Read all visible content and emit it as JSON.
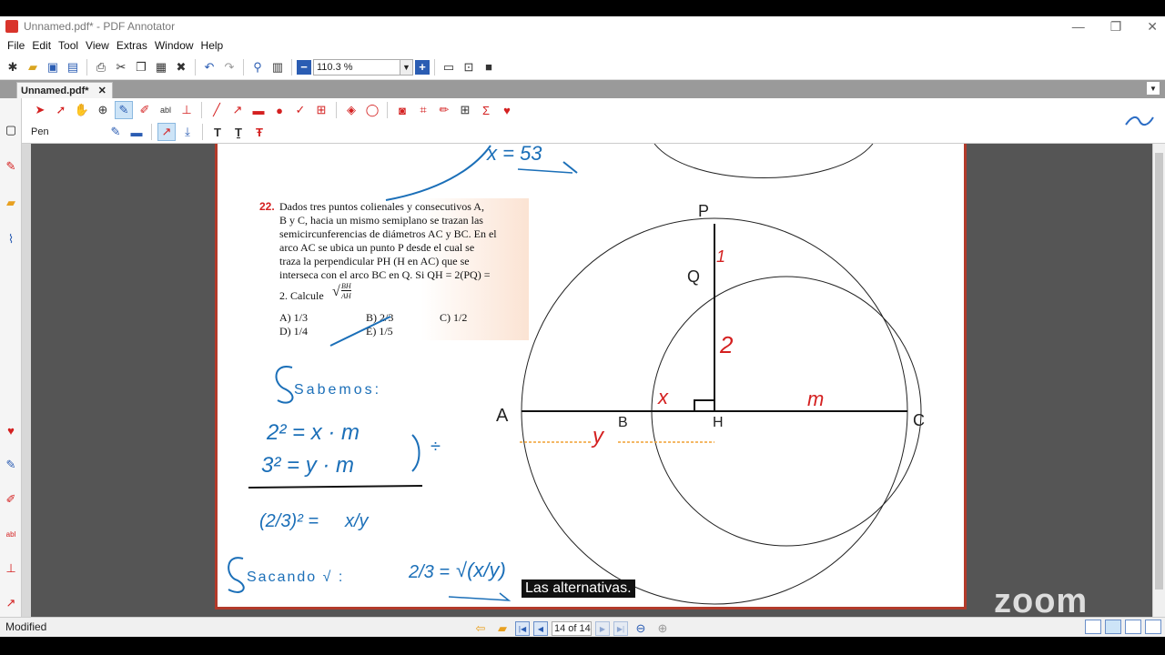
{
  "window": {
    "title": "Unnamed.pdf* - PDF Annotator",
    "minimize": "—",
    "restore": "❐",
    "close": "✕"
  },
  "menu": [
    "File",
    "Edit",
    "Tool",
    "View",
    "Extras",
    "Window",
    "Help"
  ],
  "toolbar": {
    "zoom_value": "110.3 %"
  },
  "tab": {
    "label": "Unnamed.pdf*",
    "close": "✕"
  },
  "tool_options": {
    "current_tool": "Pen"
  },
  "colors": {
    "accent": "#2b6cc4",
    "page_border": "#b23a2a",
    "ink_blue": "#1b6fb8",
    "ink_red": "#d42020",
    "ink_orange": "#f0a030"
  },
  "document": {
    "problem_number": "22.",
    "problem_lines": [
      "Dados tres puntos colienales y consecutivos A,",
      "B y C, hacia un mismo semiplano se trazan las",
      "semicircunferencias de diámetros AC y BC. En el",
      "arco AC se ubica un punto P desde el cual se",
      "traza la perpendicular PH (H en AC) que se",
      "interseca con el arco BC en Q. Si QH = 2(PQ) =",
      "2. Calcule"
    ],
    "calc_num": "BH",
    "calc_den": "AH",
    "options": [
      "A) 1/3",
      "B) 2/3",
      "C) 1/2",
      "D) 1/4",
      "E) 1/5"
    ],
    "handwriting": {
      "top_eq": "x = 53",
      "sabemos": "Sabemos:",
      "eq1": "2² = x · m",
      "eq2": "3² = y · m",
      "div": "÷",
      "ratio_left": "(2/3)² =",
      "ratio_right": "x/y",
      "sacando": "Sacando √ :",
      "result_left": "2/3 =",
      "result_right": "√(x/y)"
    },
    "points": [
      "P",
      "Q",
      "A",
      "B",
      "H",
      "C"
    ],
    "segment_labels": [
      "1",
      "2",
      "x",
      "m",
      "y"
    ]
  },
  "status": {
    "state": "Modified",
    "page": "14 of 14"
  },
  "overlay": {
    "caption": "Las alternativas.",
    "logo": "zoom"
  }
}
